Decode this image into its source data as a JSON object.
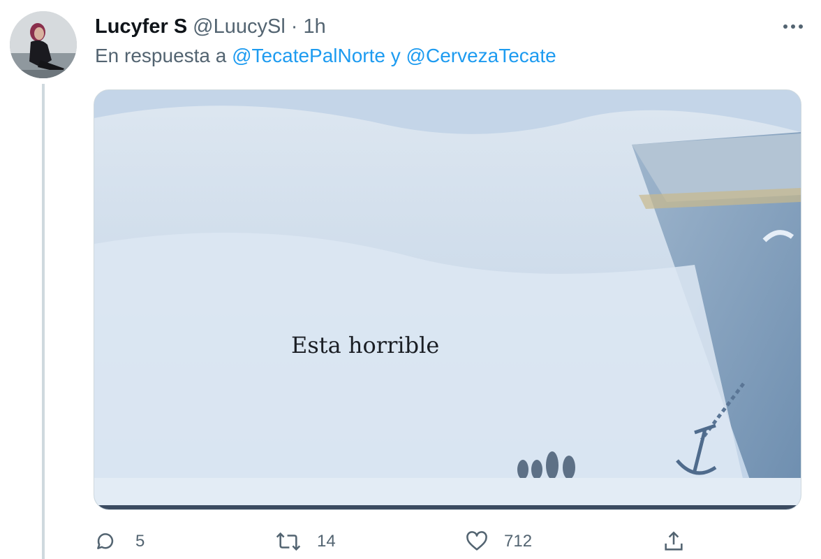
{
  "tweet": {
    "display_name": "Lucyfer S",
    "handle": "@LuucySl",
    "separator": "·",
    "time": "1h",
    "reply_prefix": "En respuesta a",
    "mention_1": "@TecatePalNorte",
    "conjunction": "y",
    "mention_2": "@CervezaTecate",
    "more_label": "•••"
  },
  "media": {
    "caption": "Esta horrible"
  },
  "actions": {
    "reply_count": "5",
    "retweet_count": "14",
    "like_count": "712"
  },
  "icons": {
    "avatar": "profile-photo",
    "more": "more-icon",
    "reply": "reply-icon",
    "retweet": "retweet-icon",
    "like": "heart-icon",
    "share": "share-icon"
  },
  "colors": {
    "link": "#1d9bf0",
    "secondary_text": "#536471",
    "thread_line": "#cfd9de"
  }
}
